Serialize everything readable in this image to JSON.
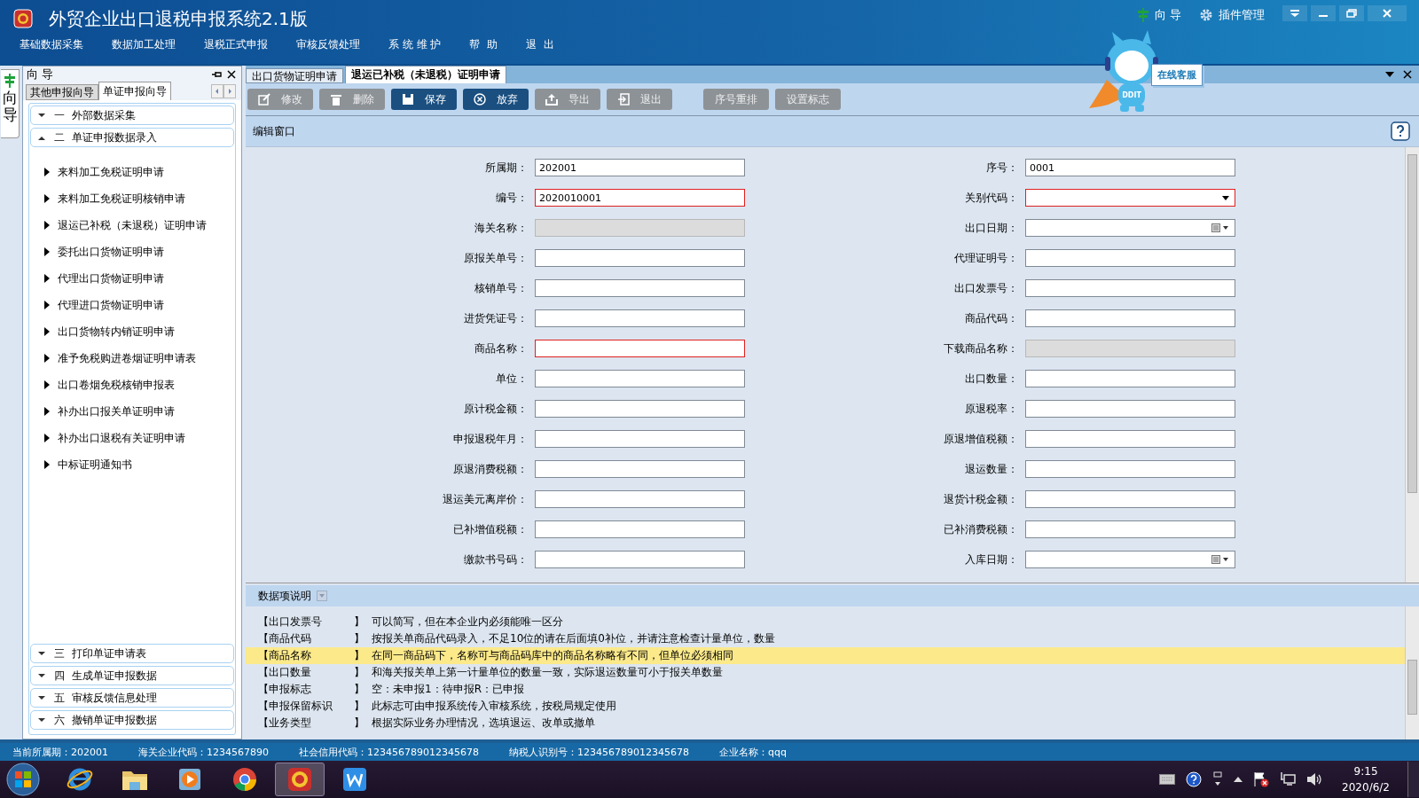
{
  "window": {
    "title": "外贸企业出口退税申报系统2.1版"
  },
  "header_links": [
    {
      "label": "向 导",
      "kind": "guide"
    },
    {
      "label": "插件管理",
      "kind": "plugin"
    }
  ],
  "menu": [
    "基础数据采集",
    "数据加工处理",
    "退税正式申报",
    "审核反馈处理",
    "系 统 维 护",
    "帮  助",
    "退  出"
  ],
  "mascot": {
    "badge": "DDIT",
    "bubble": "在线客服"
  },
  "side_tab": {
    "label": "向导"
  },
  "sidebar": {
    "title": "向 导",
    "tabs": [
      {
        "label": "其他申报向导",
        "selected": false
      },
      {
        "label": "单证申报向导",
        "selected": true
      }
    ],
    "groups": [
      {
        "label": "一  外部数据采集",
        "expanded": false
      },
      {
        "label": "二  单证申报数据录入",
        "expanded": true,
        "children": [
          "来料加工免税证明申请",
          "来料加工免税证明核销申请",
          "退运已补税（未退税）证明申请",
          "委托出口货物证明申请",
          "代理出口货物证明申请",
          "代理进口货物证明申请",
          "出口货物转内销证明申请",
          "准予免税购进卷烟证明申请表",
          "出口卷烟免税核销申报表",
          "补办出口报关单证明申请",
          "补办出口退税有关证明申请",
          "中标证明通知书"
        ]
      },
      {
        "label": "三  打印单证申请表",
        "expanded": false
      },
      {
        "label": "四  生成单证申报数据",
        "expanded": false
      },
      {
        "label": "五  审核反馈信息处理",
        "expanded": false
      },
      {
        "label": "六  撤销单证申报数据",
        "expanded": false
      }
    ]
  },
  "doc_tabs": [
    {
      "label": "出口货物证明申请",
      "selected": false
    },
    {
      "label": "退运已补税（未退税）证明申请",
      "selected": true
    }
  ],
  "toolbar": [
    {
      "label": "修改",
      "disabled": true,
      "kind": "edit"
    },
    {
      "label": "删除",
      "disabled": true,
      "kind": "delete"
    },
    {
      "label": "保存",
      "disabled": false,
      "kind": "save"
    },
    {
      "label": "放弃",
      "disabled": false,
      "kind": "cancel"
    },
    {
      "label": "导出",
      "disabled": true,
      "kind": "export"
    },
    {
      "label": "退出",
      "disabled": true,
      "kind": "exit"
    },
    {
      "label": "序号重排",
      "disabled": true,
      "kind": "plain"
    },
    {
      "label": "设置标志",
      "disabled": true,
      "kind": "plain"
    }
  ],
  "edit_window": {
    "title": "编辑窗口",
    "fields": [
      {
        "label": "所属期：",
        "value": "202001",
        "kind": "text",
        "required": false,
        "disabled": false
      },
      {
        "label": "序号：",
        "value": "0001",
        "kind": "text",
        "required": false,
        "disabled": false
      },
      {
        "label": "编号：",
        "value": "2020010001",
        "kind": "text",
        "required": true,
        "disabled": false
      },
      {
        "label": "关别代码：",
        "kind": "select",
        "required": true,
        "disabled": false
      },
      {
        "label": "海关名称：",
        "kind": "text",
        "required": false,
        "disabled": true
      },
      {
        "label": "出口日期：",
        "kind": "date",
        "required": false,
        "disabled": false
      },
      {
        "label": "原报关单号：",
        "kind": "text",
        "required": false,
        "disabled": false
      },
      {
        "label": "代理证明号：",
        "kind": "text",
        "required": false,
        "disabled": false
      },
      {
        "label": "核销单号：",
        "kind": "text",
        "required": false,
        "disabled": false
      },
      {
        "label": "出口发票号：",
        "kind": "text",
        "required": false,
        "disabled": false
      },
      {
        "label": "进货凭证号：",
        "kind": "text",
        "required": false,
        "disabled": false
      },
      {
        "label": "商品代码：",
        "kind": "text",
        "required": false,
        "disabled": false
      },
      {
        "label": "商品名称：",
        "kind": "text",
        "required": true,
        "disabled": false
      },
      {
        "label": "下载商品名称：",
        "kind": "text",
        "required": false,
        "disabled": true
      },
      {
        "label": "单位：",
        "kind": "text",
        "required": false,
        "disabled": false
      },
      {
        "label": "出口数量：",
        "kind": "text",
        "required": false,
        "disabled": false
      },
      {
        "label": "原计税金额：",
        "kind": "text",
        "required": false,
        "disabled": false
      },
      {
        "label": "原退税率：",
        "kind": "text",
        "required": false,
        "disabled": false
      },
      {
        "label": "申报退税年月：",
        "kind": "text",
        "required": false,
        "disabled": false
      },
      {
        "label": "原退增值税额：",
        "kind": "text",
        "required": false,
        "disabled": false
      },
      {
        "label": "原退消费税额：",
        "kind": "text",
        "required": false,
        "disabled": false
      },
      {
        "label": "退运数量：",
        "kind": "text",
        "required": false,
        "disabled": false
      },
      {
        "label": "退运美元离岸价：",
        "kind": "text",
        "required": false,
        "disabled": false
      },
      {
        "label": "退货计税金额：",
        "kind": "text",
        "required": false,
        "disabled": false
      },
      {
        "label": "已补增值税额：",
        "kind": "text",
        "required": false,
        "disabled": false
      },
      {
        "label": "已补消费税额：",
        "kind": "text",
        "required": false,
        "disabled": false
      },
      {
        "label": "缴款书号码：",
        "kind": "text",
        "required": false,
        "disabled": false
      },
      {
        "label": "入库日期：",
        "kind": "date",
        "required": false,
        "disabled": false
      }
    ]
  },
  "description": {
    "title": "数据项说明",
    "rows": [
      {
        "term": "【出口发票号",
        "close": "】",
        "text": "可以简写，但在本企业内必须能唯一区分",
        "selected": false
      },
      {
        "term": "【商品代码",
        "close": "】",
        "text": "按报关单商品代码录入，不足10位的请在后面填0补位，并请注意检查计量单位，数量",
        "selected": false
      },
      {
        "term": "【商品名称",
        "close": "】",
        "text": "在同一商品码下，名称可与商品码库中的商品名称略有不同，但单位必须相同",
        "selected": true
      },
      {
        "term": "【出口数量",
        "close": "】",
        "text": "和海关报关单上第一计量单位的数量一致，实际退运数量可小于报关单数量",
        "selected": false
      },
      {
        "term": "【申报标志",
        "close": "】",
        "text": "空：未申报1：待申报R：已申报",
        "selected": false
      },
      {
        "term": "【申报保留标识",
        "close": "】",
        "text": "此标志可由申报系统传入审核系统，按税局规定使用",
        "selected": false
      },
      {
        "term": "【业务类型",
        "close": "】",
        "text": "根据实际业务办理情况，选填退运、改单或撤单",
        "selected": false
      }
    ]
  },
  "status_bar": [
    "当前所属期：202001",
    "海关企业代码：1234567890",
    "社会信用代码：123456789012345678",
    "纳税人识别号：123456789012345678",
    "企业名称：qqq"
  ],
  "taskbar": {
    "apps": [
      {
        "kind": "browser-e",
        "selected": false
      },
      {
        "kind": "folder",
        "selected": false
      },
      {
        "kind": "media",
        "selected": false
      },
      {
        "kind": "chrome",
        "selected": false
      },
      {
        "kind": "tax",
        "selected": true
      },
      {
        "kind": "w",
        "selected": false
      }
    ],
    "time": "9:15",
    "date": "2020/6/2"
  }
}
